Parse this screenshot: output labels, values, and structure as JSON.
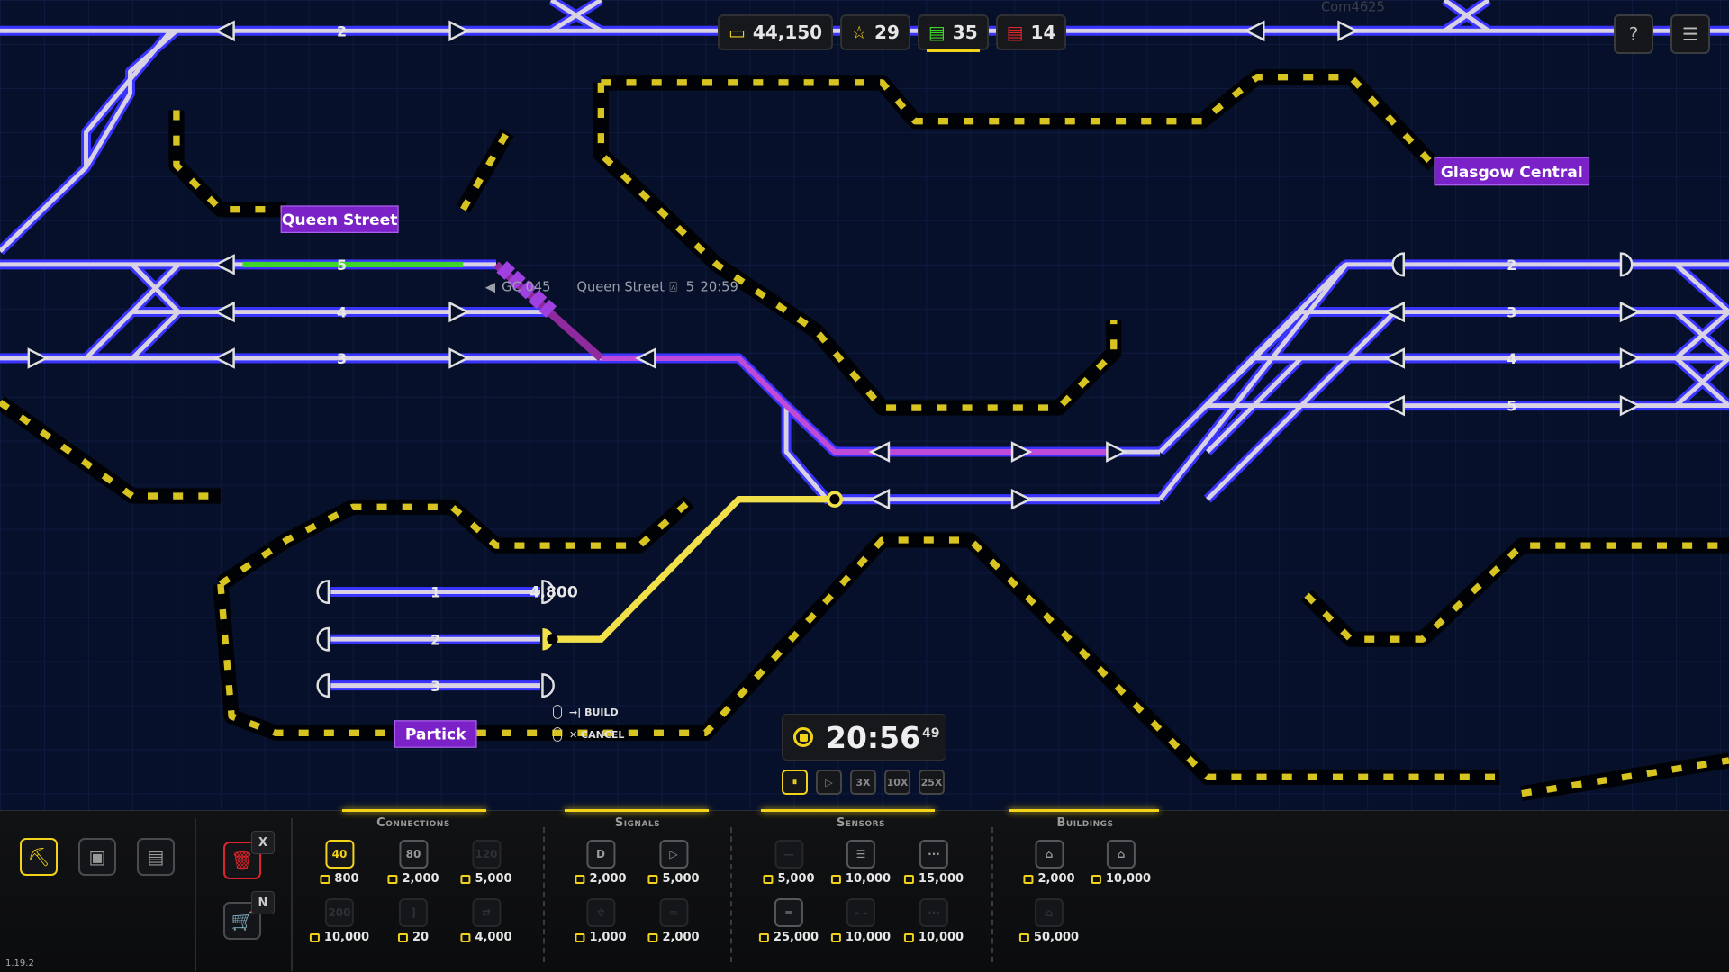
{
  "hud": {
    "money": "44,150",
    "stars": "29",
    "trains_active": "35",
    "trains_problem": "14"
  },
  "colors": {
    "accent": "#f2d21b",
    "track_glow": "#3a34ff",
    "station": "#7a22c8",
    "hazard": "#d8c421",
    "alert": "#e0262c",
    "ok": "#3fd42a"
  },
  "map": {
    "stations": {
      "queen_street": "Queen Street",
      "glasgow_central": "Glasgow Central",
      "partick": "Partick"
    },
    "platforms_queen_street": [
      "5",
      "4",
      "3"
    ],
    "platforms_partick": [
      "1",
      "2",
      "3"
    ],
    "platforms_central": [
      "2",
      "3",
      "4",
      "5"
    ],
    "top_platform": "2",
    "train_tag": {
      "id": "GC 045",
      "destination": "Queen Street",
      "platform": "5",
      "time": "20:59"
    },
    "faded_train": "Com4625",
    "build_cost": "4,800",
    "hints": {
      "build": "→| BUILD",
      "cancel": "✕ CANCEL"
    }
  },
  "clock": {
    "time": "20:56",
    "seconds": "49",
    "speeds": [
      "⏸",
      "▷",
      "3X",
      "10X",
      "25X"
    ],
    "active_speed": 0
  },
  "toolbar": {
    "modes": [
      {
        "icon": "construction-icon",
        "glyph": "⛏",
        "active": true
      },
      {
        "icon": "chip-icon",
        "glyph": "▣",
        "active": false
      },
      {
        "icon": "book-icon",
        "glyph": "▤",
        "active": false
      }
    ],
    "delete_key": "X",
    "shop_key": "N",
    "version": "1.19.2",
    "categories": [
      {
        "name": "Connections",
        "items": [
          {
            "icon": "track-40-icon",
            "label": "40",
            "price": "800",
            "state": "on"
          },
          {
            "icon": "track-80-icon",
            "label": "80",
            "price": "2,000",
            "state": "normal"
          },
          {
            "icon": "track-120-icon",
            "label": "120",
            "price": "5,000",
            "state": "off"
          },
          {
            "icon": "track-200-icon",
            "label": "200",
            "price": "10,000",
            "state": "off"
          },
          {
            "icon": "buffer-icon",
            "label": "]",
            "price": "20",
            "state": "off"
          },
          {
            "icon": "turn-icon",
            "label": "⇄",
            "price": "4,000",
            "state": "off"
          }
        ]
      },
      {
        "name": "Signals",
        "items": [
          {
            "icon": "platform-signal-icon",
            "label": "D",
            "price": "2,000",
            "state": "normal"
          },
          {
            "icon": "signal-icon",
            "label": "▷",
            "price": "5,000",
            "state": "normal"
          },
          {
            "icon": "bug-signal-icon",
            "label": "✲",
            "price": "1,000",
            "state": "off"
          },
          {
            "icon": "infinity-signal-icon",
            "label": "∞",
            "price": "2,000",
            "state": "off"
          }
        ]
      },
      {
        "name": "Sensors",
        "items": [
          {
            "icon": "sensor-line-icon",
            "label": "—",
            "price": "5,000",
            "state": "off"
          },
          {
            "icon": "sensor-count-icon",
            "label": "☰",
            "price": "10,000",
            "state": "normal"
          },
          {
            "icon": "sensor-dots-icon",
            "label": "···",
            "price": "15,000",
            "state": "normal"
          },
          {
            "icon": "sensor-double-icon",
            "label": "═",
            "price": "25,000",
            "state": "normal"
          },
          {
            "icon": "sensor-dash-icon",
            "label": "- -",
            "price": "10,000",
            "state": "off"
          },
          {
            "icon": "sensor-dots2-icon",
            "label": "···",
            "price": "10,000",
            "state": "off"
          }
        ]
      },
      {
        "name": "Buildings",
        "items": [
          {
            "icon": "station-icon",
            "label": "⌂",
            "price": "2,000",
            "state": "normal"
          },
          {
            "icon": "large-station-icon",
            "label": "⌂",
            "price": "10,000",
            "state": "normal"
          },
          {
            "icon": "depot-icon",
            "label": "⌂",
            "price": "50,000",
            "state": "off"
          }
        ]
      }
    ]
  }
}
